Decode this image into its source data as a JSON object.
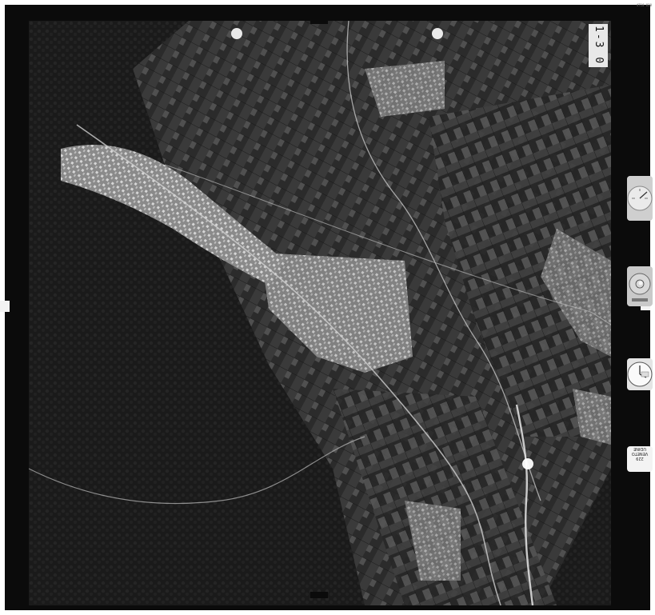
{
  "frame_code": "1-3 0",
  "edge_label_top_right": "4710 830",
  "edge_label_top_mid": "",
  "card_text": [
    "UDINE",
    "VENETO",
    "229"
  ],
  "instruments": [
    "altimeter-icon",
    "level-bubble-icon",
    "clock-icon",
    "data-card-icon"
  ],
  "colors": {
    "frame": "#0b0b0b",
    "terrain_dark": "#1f1f1f",
    "urban": "#bdbdbd",
    "water": "#dcdcdc"
  }
}
